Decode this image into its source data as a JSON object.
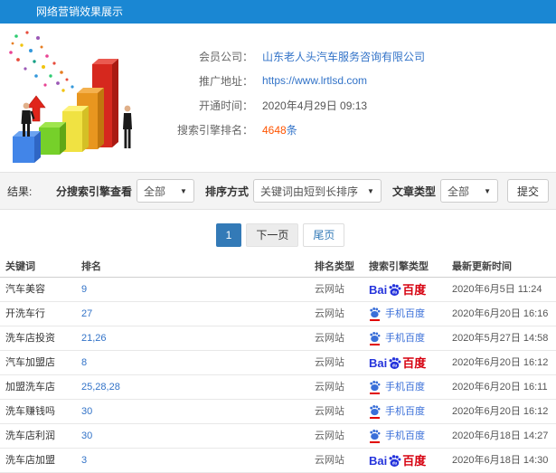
{
  "header": {
    "title": "网络营销效果展示"
  },
  "info": {
    "rows": [
      {
        "label": "会员公司：",
        "value": "山东老人头汽车服务咨询有限公司"
      },
      {
        "label": "推广地址：",
        "value": "https://www.lrtlsd.com"
      },
      {
        "label": "开通时间：",
        "value": "2020年4月29日 09:13"
      },
      {
        "label": "搜索引擎排名：",
        "value": "4648",
        "suffix": "条"
      }
    ]
  },
  "filters": {
    "result_label": "结果:",
    "engine_filter_label": "分搜索引擎查看",
    "engine_filter_value": "全部",
    "sort_label": "排序方式",
    "sort_value": "关键词由短到长排序",
    "article_type_label": "文章类型",
    "article_type_value": "全部",
    "submit_label": "提交",
    "caret": "▼"
  },
  "pagination": {
    "current": "1",
    "next_label": "下一页",
    "last_label": "尾页"
  },
  "table": {
    "headers": [
      "关键词",
      "排名",
      "排名类型",
      "搜索引擎类型",
      "最新更新时间"
    ],
    "rows": [
      {
        "keyword": "汽车美容",
        "rank": "9",
        "rank_type": "云网站",
        "engine": "百度",
        "updated": "2020年6月5日 11:24"
      },
      {
        "keyword": "开洗车行",
        "rank": "27",
        "rank_type": "云网站",
        "engine": "手机百度",
        "updated": "2020年6月20日 16:16"
      },
      {
        "keyword": "洗车店投资",
        "rank": "21,26",
        "rank_type": "云网站",
        "engine": "手机百度",
        "updated": "2020年5月27日 14:58"
      },
      {
        "keyword": "汽车加盟店",
        "rank": "8",
        "rank_type": "云网站",
        "engine": "百度",
        "updated": "2020年6月20日 16:12"
      },
      {
        "keyword": "加盟洗车店",
        "rank": "25,28,28",
        "rank_type": "云网站",
        "engine": "手机百度",
        "updated": "2020年6月20日 16:11"
      },
      {
        "keyword": "洗车赚钱吗",
        "rank": "30",
        "rank_type": "云网站",
        "engine": "手机百度",
        "updated": "2020年6月20日 16:12"
      },
      {
        "keyword": "洗车店利润",
        "rank": "30",
        "rank_type": "云网站",
        "engine": "手机百度",
        "updated": "2020年6月18日 14:27"
      },
      {
        "keyword": "洗车店加盟",
        "rank": "3",
        "rank_type": "云网站",
        "engine": "百度",
        "updated": "2020年6月18日 14:30"
      }
    ]
  },
  "baidu_logo": {
    "bai": "Bai",
    "du": "du"
  },
  "colors": {
    "topbar_blue": "#1a87d3",
    "link_blue": "#3273c8",
    "highlight_orange": "#ff5400",
    "baidu_blue": "#2534dc",
    "baidu_red": "#d6000f",
    "mobile_baidu_blue": "#3a6fd8",
    "pagination_active": "#337ab7",
    "filter_bg": "#f4f4f4"
  }
}
